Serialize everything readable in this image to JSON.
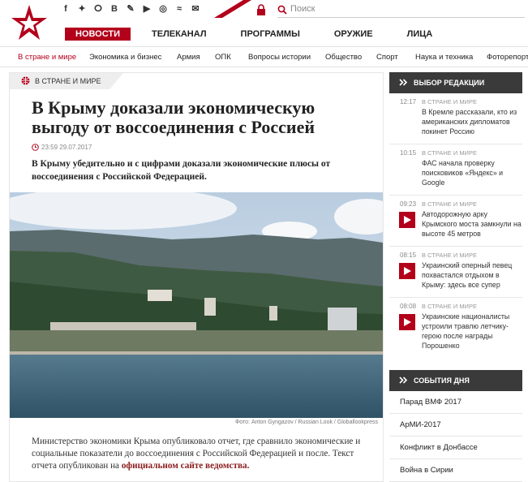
{
  "header": {
    "search_placeholder": "Поиск",
    "social_icons": [
      "facebook-icon",
      "twitter-icon",
      "ok-icon",
      "vk-icon",
      "livejournal-icon",
      "youtube-icon",
      "instagram-icon",
      "rss-icon",
      "mail-icon"
    ],
    "brand_color": "#b3001b"
  },
  "mainnav": [
    "НОВОСТИ",
    "ТЕЛЕКАНАЛ",
    "ПРОГРАММЫ",
    "ОРУЖИЕ",
    "ЛИЦА"
  ],
  "subnav": [
    "В стране и мире",
    "Экономика и бизнес",
    "Армия",
    "ОПК",
    "Вопросы истории",
    "Общество",
    "Спорт",
    "Наука и техника",
    "Фоторепорт"
  ],
  "article": {
    "tag": "В СТРАНЕ И МИРЕ",
    "title": "В Крыму доказали экономическую выгоду от воссоединения с Россией",
    "date": "23:59 29.07.2017",
    "lead": "В Крыму убедительно и с цифрами доказали экономические плюсы от воссоединения с Российской Федерацией.",
    "photo_credit": "Фото: Anton Gyngazov / Russian Look / Globallookpress",
    "body_prefix": "Министерство экономики Крыма опубликовало отчет, где сравнило экономические и социальные показатели до воссоединения с Российской Федерацией и после. Текст отчета опубликован на ",
    "body_link": "официальном сайте ведомства."
  },
  "sidebar": {
    "title": "ВЫБОР РЕДАКЦИИ",
    "items": [
      {
        "time": "12:17",
        "cat": "В СТРАНЕ И МИРЕ",
        "text": "В Кремле рассказали, кто из американских дипломатов покинет Россию"
      },
      {
        "time": "10:15",
        "cat": "В СТРАНЕ И МИРЕ",
        "text": "ФАС начала проверку поисковиков «Яндекс» и Google"
      },
      {
        "time": "09:23",
        "cat": "В СТРАНЕ И МИРЕ",
        "text": "Автодорожную арку Крымского моста замкнули на высоте 45 метров"
      },
      {
        "time": "08:15",
        "cat": "В СТРАНЕ И МИРЕ",
        "text": "Украинский оперный певец похвастался отдыхом в Крыму: здесь все супер"
      },
      {
        "time": "08:08",
        "cat": "В СТРАНЕ И МИРЕ",
        "text": "Украинские националисты устроили травлю летчику-герою после награды Порошенко"
      }
    ]
  },
  "events": {
    "title": "СОБЫТИЯ ДНЯ",
    "items": [
      "Парад ВМФ 2017",
      "АрМИ-2017",
      "Конфликт в Донбассе",
      "Война в Сирии"
    ]
  }
}
